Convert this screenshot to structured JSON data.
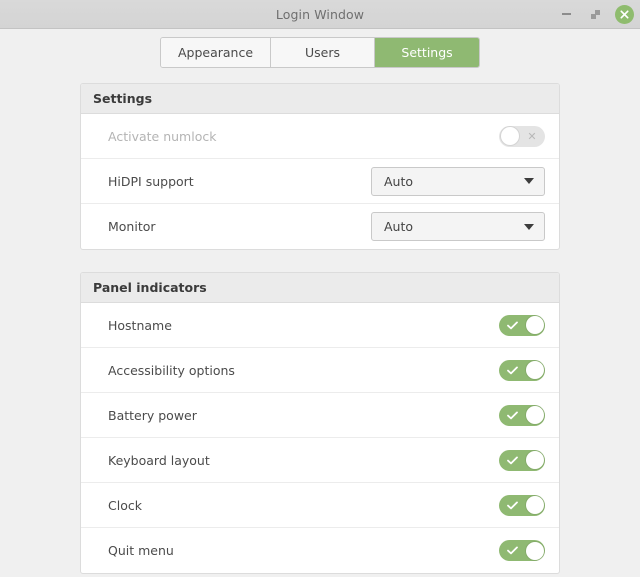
{
  "window": {
    "title": "Login Window",
    "controls": {
      "minimize": "minimize",
      "maximize": "maximize",
      "close": "close"
    }
  },
  "tabs": [
    {
      "label": "Appearance",
      "active": false
    },
    {
      "label": "Users",
      "active": false
    },
    {
      "label": "Settings",
      "active": true
    }
  ],
  "panels": [
    {
      "header": "Settings",
      "rows": [
        {
          "label": "Activate numlock",
          "control": "toggle",
          "state": "off",
          "disabled": true
        },
        {
          "label": "HiDPI support",
          "control": "dropdown",
          "value": "Auto",
          "disabled": false
        },
        {
          "label": "Monitor",
          "control": "dropdown",
          "value": "Auto",
          "disabled": false
        }
      ]
    },
    {
      "header": "Panel indicators",
      "rows": [
        {
          "label": "Hostname",
          "control": "toggle",
          "state": "on",
          "disabled": false
        },
        {
          "label": "Accessibility options",
          "control": "toggle",
          "state": "on",
          "disabled": false
        },
        {
          "label": "Battery power",
          "control": "toggle",
          "state": "on",
          "disabled": false
        },
        {
          "label": "Keyboard layout",
          "control": "toggle",
          "state": "on",
          "disabled": false
        },
        {
          "label": "Clock",
          "control": "toggle",
          "state": "on",
          "disabled": false
        },
        {
          "label": "Quit menu",
          "control": "toggle",
          "state": "on",
          "disabled": false
        }
      ]
    }
  ],
  "colors": {
    "accent": "#8fb972",
    "close_button": "#8fbc6e",
    "window_bg": "#f0f0f0",
    "titlebar": "#d6d6d6",
    "panel_header": "#ebebeb"
  },
  "icons": {
    "toggle_on": "check-icon",
    "toggle_off": "x-icon",
    "dropdown": "chevron-down-icon"
  }
}
